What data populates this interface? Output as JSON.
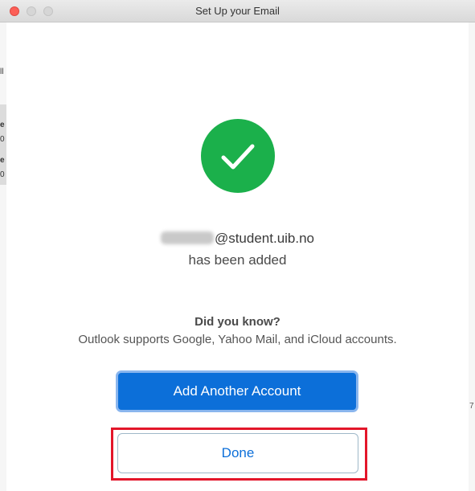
{
  "window": {
    "title": "Set Up your Email"
  },
  "background": {
    "left_fragments": [
      "ll",
      "e",
      "0",
      "e",
      "0"
    ],
    "right_fragments": [
      "7"
    ]
  },
  "dialog": {
    "icon": "checkmark-circle-icon",
    "email_domain": "@student.uib.no",
    "added_text": "has been added",
    "did_you_know": "Did you know?",
    "supports_text": "Outlook supports Google, Yahoo Mail, and iCloud accounts.",
    "add_button_label": "Add Another Account",
    "done_button_label": "Done"
  },
  "colors": {
    "success_green": "#1bb04b",
    "primary_blue": "#0c6fd9",
    "highlight_red": "#e3162a",
    "close_red": "#fc5f57"
  }
}
